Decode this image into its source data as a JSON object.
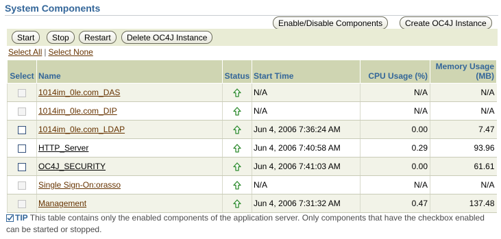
{
  "header": {
    "title": "System Components"
  },
  "toolbar": {
    "enable_disable_label": "Enable/Disable Components",
    "create_oc4j_label": "Create OC4J Instance"
  },
  "actions": {
    "start_label": "Start",
    "stop_label": "Stop",
    "restart_label": "Restart",
    "delete_label": "Delete OC4J Instance"
  },
  "selection": {
    "select_all": "Select All",
    "select_none": "Select None"
  },
  "table": {
    "columns": {
      "select": "Select",
      "name": "Name",
      "status": "Status",
      "start_time": "Start Time",
      "cpu": "CPU Usage (%)",
      "memory": "Memory Usage (MB)"
    },
    "rows": [
      {
        "name": "1014im_0le.com_DAS",
        "status": "up",
        "start_time": "N/A",
        "cpu": "N/A",
        "memory": "N/A",
        "checkbox_enabled": false
      },
      {
        "name": "1014im_0le.com_DIP",
        "status": "up",
        "start_time": "N/A",
        "cpu": "N/A",
        "memory": "N/A",
        "checkbox_enabled": false
      },
      {
        "name": "1014im_0le.com_LDAP",
        "status": "up",
        "start_time": "Jun 4, 2006 7:36:24 AM",
        "cpu": "0.00",
        "memory": "7.47",
        "checkbox_enabled": true
      },
      {
        "name": "HTTP_Server",
        "status": "up",
        "start_time": "Jun 4, 2006 7:40:58 AM",
        "cpu": "0.29",
        "memory": "93.96",
        "checkbox_enabled": true
      },
      {
        "name": "OC4J_SECURITY",
        "status": "up",
        "start_time": "Jun 4, 2006 7:41:03 AM",
        "cpu": "0.00",
        "memory": "61.61",
        "checkbox_enabled": true
      },
      {
        "name": "Single Sign-On:orasso",
        "status": "up",
        "start_time": "N/A",
        "cpu": "N/A",
        "memory": "N/A",
        "checkbox_enabled": false
      },
      {
        "name": "Management",
        "status": "up",
        "start_time": "Jun 4, 2006 7:31:32 AM",
        "cpu": "0.47",
        "memory": "137.48",
        "checkbox_enabled": false
      }
    ]
  },
  "tip": {
    "label": "TIP",
    "text": "This table contains only the enabled components of the application server. Only components that have the checkbox enabled can be started or stopped."
  },
  "colors": {
    "accent": "#336699",
    "link": "#663300",
    "status_up": "#2e8b2e",
    "header_bg": "#cfd5b2"
  }
}
